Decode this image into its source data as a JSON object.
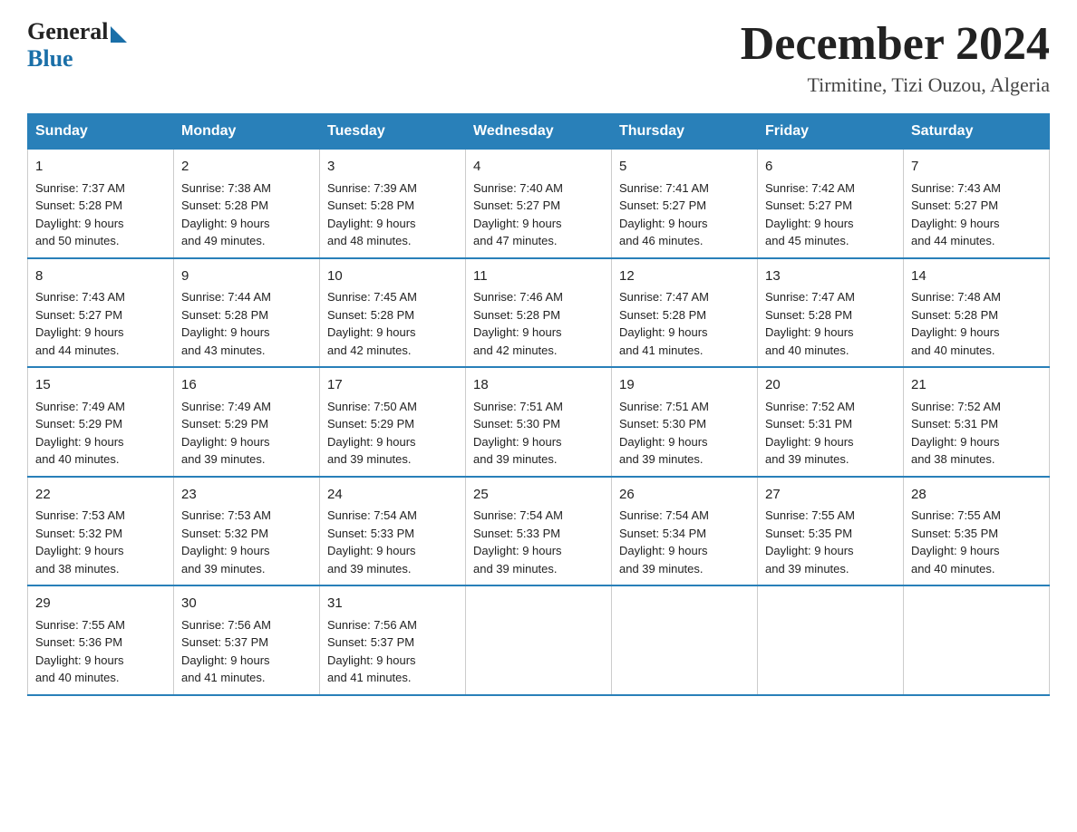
{
  "logo": {
    "general": "General",
    "blue": "Blue"
  },
  "title": {
    "month_year": "December 2024",
    "location": "Tirmitine, Tizi Ouzou, Algeria"
  },
  "headers": [
    "Sunday",
    "Monday",
    "Tuesday",
    "Wednesday",
    "Thursday",
    "Friday",
    "Saturday"
  ],
  "weeks": [
    [
      {
        "day": "1",
        "sunrise": "7:37 AM",
        "sunset": "5:28 PM",
        "daylight": "9 hours and 50 minutes."
      },
      {
        "day": "2",
        "sunrise": "7:38 AM",
        "sunset": "5:28 PM",
        "daylight": "9 hours and 49 minutes."
      },
      {
        "day": "3",
        "sunrise": "7:39 AM",
        "sunset": "5:28 PM",
        "daylight": "9 hours and 48 minutes."
      },
      {
        "day": "4",
        "sunrise": "7:40 AM",
        "sunset": "5:27 PM",
        "daylight": "9 hours and 47 minutes."
      },
      {
        "day": "5",
        "sunrise": "7:41 AM",
        "sunset": "5:27 PM",
        "daylight": "9 hours and 46 minutes."
      },
      {
        "day": "6",
        "sunrise": "7:42 AM",
        "sunset": "5:27 PM",
        "daylight": "9 hours and 45 minutes."
      },
      {
        "day": "7",
        "sunrise": "7:43 AM",
        "sunset": "5:27 PM",
        "daylight": "9 hours and 44 minutes."
      }
    ],
    [
      {
        "day": "8",
        "sunrise": "7:43 AM",
        "sunset": "5:27 PM",
        "daylight": "9 hours and 44 minutes."
      },
      {
        "day": "9",
        "sunrise": "7:44 AM",
        "sunset": "5:28 PM",
        "daylight": "9 hours and 43 minutes."
      },
      {
        "day": "10",
        "sunrise": "7:45 AM",
        "sunset": "5:28 PM",
        "daylight": "9 hours and 42 minutes."
      },
      {
        "day": "11",
        "sunrise": "7:46 AM",
        "sunset": "5:28 PM",
        "daylight": "9 hours and 42 minutes."
      },
      {
        "day": "12",
        "sunrise": "7:47 AM",
        "sunset": "5:28 PM",
        "daylight": "9 hours and 41 minutes."
      },
      {
        "day": "13",
        "sunrise": "7:47 AM",
        "sunset": "5:28 PM",
        "daylight": "9 hours and 40 minutes."
      },
      {
        "day": "14",
        "sunrise": "7:48 AM",
        "sunset": "5:28 PM",
        "daylight": "9 hours and 40 minutes."
      }
    ],
    [
      {
        "day": "15",
        "sunrise": "7:49 AM",
        "sunset": "5:29 PM",
        "daylight": "9 hours and 40 minutes."
      },
      {
        "day": "16",
        "sunrise": "7:49 AM",
        "sunset": "5:29 PM",
        "daylight": "9 hours and 39 minutes."
      },
      {
        "day": "17",
        "sunrise": "7:50 AM",
        "sunset": "5:29 PM",
        "daylight": "9 hours and 39 minutes."
      },
      {
        "day": "18",
        "sunrise": "7:51 AM",
        "sunset": "5:30 PM",
        "daylight": "9 hours and 39 minutes."
      },
      {
        "day": "19",
        "sunrise": "7:51 AM",
        "sunset": "5:30 PM",
        "daylight": "9 hours and 39 minutes."
      },
      {
        "day": "20",
        "sunrise": "7:52 AM",
        "sunset": "5:31 PM",
        "daylight": "9 hours and 39 minutes."
      },
      {
        "day": "21",
        "sunrise": "7:52 AM",
        "sunset": "5:31 PM",
        "daylight": "9 hours and 38 minutes."
      }
    ],
    [
      {
        "day": "22",
        "sunrise": "7:53 AM",
        "sunset": "5:32 PM",
        "daylight": "9 hours and 38 minutes."
      },
      {
        "day": "23",
        "sunrise": "7:53 AM",
        "sunset": "5:32 PM",
        "daylight": "9 hours and 39 minutes."
      },
      {
        "day": "24",
        "sunrise": "7:54 AM",
        "sunset": "5:33 PM",
        "daylight": "9 hours and 39 minutes."
      },
      {
        "day": "25",
        "sunrise": "7:54 AM",
        "sunset": "5:33 PM",
        "daylight": "9 hours and 39 minutes."
      },
      {
        "day": "26",
        "sunrise": "7:54 AM",
        "sunset": "5:34 PM",
        "daylight": "9 hours and 39 minutes."
      },
      {
        "day": "27",
        "sunrise": "7:55 AM",
        "sunset": "5:35 PM",
        "daylight": "9 hours and 39 minutes."
      },
      {
        "day": "28",
        "sunrise": "7:55 AM",
        "sunset": "5:35 PM",
        "daylight": "9 hours and 40 minutes."
      }
    ],
    [
      {
        "day": "29",
        "sunrise": "7:55 AM",
        "sunset": "5:36 PM",
        "daylight": "9 hours and 40 minutes."
      },
      {
        "day": "30",
        "sunrise": "7:56 AM",
        "sunset": "5:37 PM",
        "daylight": "9 hours and 41 minutes."
      },
      {
        "day": "31",
        "sunrise": "7:56 AM",
        "sunset": "5:37 PM",
        "daylight": "9 hours and 41 minutes."
      },
      null,
      null,
      null,
      null
    ]
  ],
  "labels": {
    "sunrise": "Sunrise:",
    "sunset": "Sunset:",
    "daylight": "Daylight:"
  }
}
